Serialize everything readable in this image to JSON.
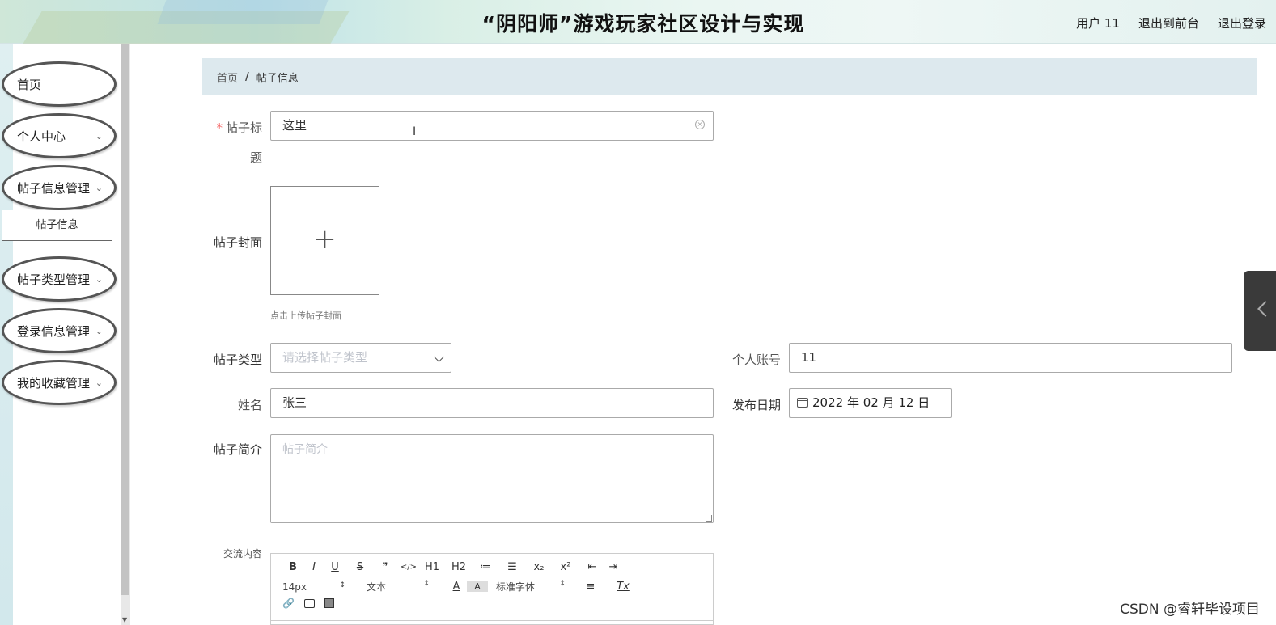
{
  "header": {
    "title": "“阴阳师”游戏玩家社区设计与实现",
    "user_label": "用户 11",
    "back_front_label": "退出到前台",
    "logout_label": "退出登录"
  },
  "sidebar": {
    "items": [
      {
        "label": "首页",
        "has_chevron": false
      },
      {
        "label": "个人中心",
        "has_chevron": true
      },
      {
        "label": "帖子信息管理",
        "has_chevron": true
      },
      {
        "label": "帖子类型管理",
        "has_chevron": true
      },
      {
        "label": "登录信息管理",
        "has_chevron": true
      },
      {
        "label": "我的收藏管理",
        "has_chevron": true
      }
    ],
    "subitem": "帖子信息"
  },
  "breadcrumb": {
    "home": "首页",
    "separator": "/",
    "current": "帖子信息"
  },
  "form": {
    "title_label_line1": "帖子标",
    "title_label_line2": "题",
    "title_required_mark": "*",
    "title_value": "这里",
    "cover_label": "帖子封面",
    "cover_plus": "+",
    "cover_hint": "点击上传帖子封面",
    "type_label": "帖子类型",
    "type_placeholder": "请选择帖子类型",
    "account_label": "个人账号",
    "account_value": "11",
    "name_label": "姓名",
    "name_value": "张三",
    "date_label": "发布日期",
    "date_value": "2022 年 02 月 12 日",
    "intro_label": "帖子简介",
    "intro_placeholder": "帖子简介",
    "content_label": "交流内容"
  },
  "editor_toolbar": {
    "row1": [
      "B",
      "I",
      "U",
      "S",
      "❞",
      "</>",
      "H1",
      "H2",
      "≔",
      "☰",
      "x₂",
      "x²",
      "⇤",
      "⇥"
    ],
    "size_select": "14px",
    "header_select": "文本",
    "font_select": "标准字体",
    "color_btn": "A",
    "bg_btn": "A",
    "align_btn": "≡",
    "clear_btn": "Tx",
    "row3": [
      "link",
      "image",
      "video"
    ]
  },
  "watermark": "CSDN @睿轩毕设项目",
  "colors": {
    "breadcrumb_bg": "#dde9ee",
    "required": "#f56c6c",
    "menu_border": "#555555"
  }
}
